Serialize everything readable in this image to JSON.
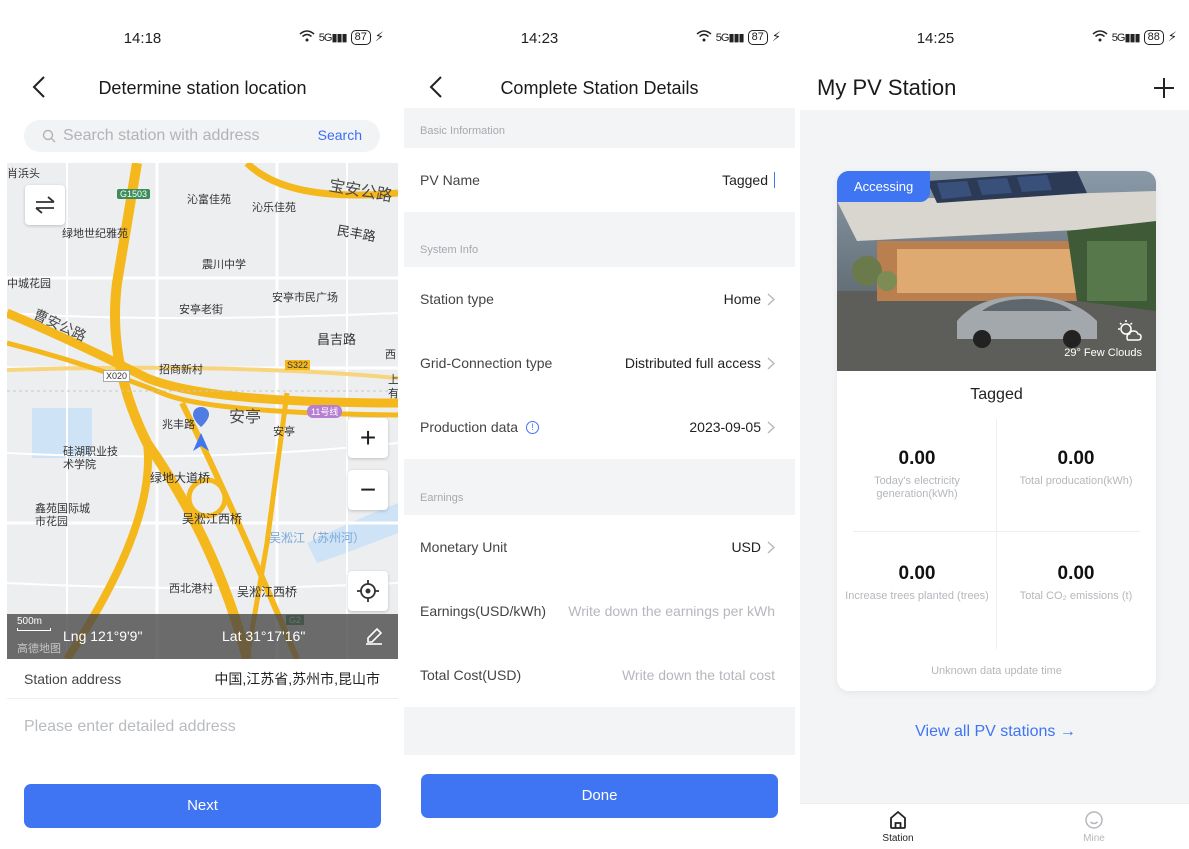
{
  "screen1": {
    "status": {
      "time": "14:18",
      "battery": "87"
    },
    "title": "Determine station location",
    "search": {
      "placeholder": "Search station with address",
      "button": "Search"
    },
    "map": {
      "labels": [
        "肖浜头",
        "沁富佳苑",
        "沁乐佳苑",
        "宝安公路",
        "绿地世纪雅苑",
        "民丰路",
        "震川中学",
        "中城花园",
        "安亭老街",
        "安亭市民广场",
        "曹安公路",
        "昌吉路",
        "招商新村",
        "安亭",
        "兆丰路",
        "安亭",
        "硅湖职业技术学院",
        "绿地大道桥",
        "鑫苑国际城市花园",
        "吴淞江西桥",
        "吴淞江（苏州河）",
        "西北港村",
        "吴淞江西桥",
        "西",
        "上",
        "有"
      ],
      "road_tags": [
        "G1503",
        "X020",
        "S322",
        "11号线",
        "G2"
      ],
      "scale": "500m",
      "provider": "高德地图",
      "lng": "Lng 121°9'9\"",
      "lat": "Lat 31°17'16\"",
      "zoom_in": "+",
      "zoom_out": "−"
    },
    "address_label": "Station address",
    "address_value": "中国,江苏省,苏州市,昆山市",
    "detail_placeholder": "Please enter detailed address",
    "next": "Next"
  },
  "screen2": {
    "status": {
      "time": "14:23",
      "battery": "87"
    },
    "title": "Complete Station Details",
    "groups": {
      "basic": "Basic Information",
      "system": "System Info",
      "earnings": "Earnings"
    },
    "pv_name": {
      "label": "PV Name",
      "value": "Tagged"
    },
    "station_type": {
      "label": "Station type",
      "value": "Home"
    },
    "grid_type": {
      "label": "Grid-Connection type",
      "value": "Distributed full access"
    },
    "production": {
      "label": "Production data",
      "value": "2023-09-05"
    },
    "monetary": {
      "label": "Monetary Unit",
      "value": "USD"
    },
    "earnings": {
      "label": "Earnings(USD/kWh)",
      "placeholder": "Write down the earnings per kWh"
    },
    "total_cost": {
      "label": "Total Cost(USD)",
      "placeholder": "Write down the total cost"
    },
    "done": "Done"
  },
  "screen3": {
    "status": {
      "time": "14:25",
      "battery": "88"
    },
    "title": "My PV Station",
    "card": {
      "badge": "Accessing",
      "weather": "29° Few Clouds",
      "name": "Tagged",
      "metrics": [
        {
          "value": "0.00",
          "label": "Today's electricity generation(kWh)"
        },
        {
          "value": "0.00",
          "label": "Total producation(kWh)"
        },
        {
          "value": "0.00",
          "label": "Increase trees planted (trees)"
        },
        {
          "value": "0.00",
          "label": "Total CO₂ emissions (t)"
        }
      ],
      "update": "Unknown data update time"
    },
    "view_all": "View all PV stations →",
    "tabs": {
      "station": "Station",
      "mine": "Mine"
    }
  },
  "colors": {
    "accent": "#3f74f2",
    "road_main": "#f5b81c",
    "map_bg": "#eceef0"
  }
}
